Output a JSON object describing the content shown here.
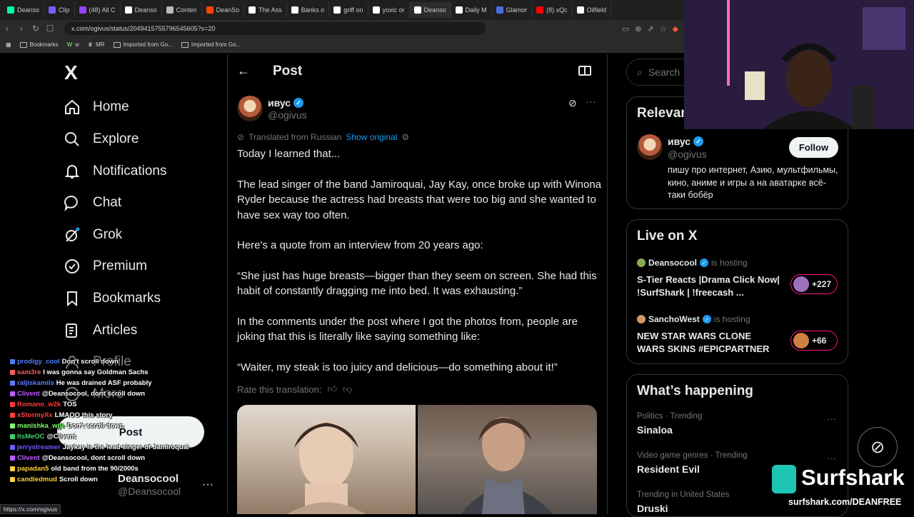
{
  "browser": {
    "tabs": [
      {
        "label": "Deanso",
        "color": "#0fa"
      },
      {
        "label": "Clip",
        "color": "#7a5cff"
      },
      {
        "label": "(48) All C",
        "color": "#9146ff"
      },
      {
        "label": "Deanso",
        "color": "#ffffff"
      },
      {
        "label": "Conten",
        "color": "#bbbbbb"
      },
      {
        "label": "DeanSo",
        "color": "#ff4500"
      },
      {
        "label": "The Ass",
        "color": "#ffffff"
      },
      {
        "label": "Banks o",
        "color": "#ffffff"
      },
      {
        "label": "griff on",
        "color": "#ffffff"
      },
      {
        "label": "yoxic or",
        "color": "#ffffff"
      },
      {
        "label": "Deanso",
        "color": "#ffffff"
      },
      {
        "label": "Daily M",
        "color": "#ffffff"
      },
      {
        "label": "Glamor",
        "color": "#4a6ee0"
      },
      {
        "label": "(8) xQc",
        "color": "#ff0000"
      },
      {
        "label": "Oilfield",
        "color": "#ffffff"
      }
    ],
    "url": "x.com/ogivus/status/2049415755796545605?s=20",
    "bookmarks": [
      "Bookmarks",
      "w",
      "MR",
      "Imported from Go...",
      "Imported from Go..."
    ],
    "status_url": "https://x.com/ogivus"
  },
  "nav": {
    "logo": "X",
    "items": [
      {
        "label": "Home"
      },
      {
        "label": "Explore"
      },
      {
        "label": "Notifications"
      },
      {
        "label": "Chat"
      },
      {
        "label": "Grok"
      },
      {
        "label": "Premium"
      },
      {
        "label": "Bookmarks"
      },
      {
        "label": "Articles"
      },
      {
        "label": "Profile"
      },
      {
        "label": "More"
      }
    ],
    "post_button": "Post",
    "account_name": "Deansocool",
    "account_handle": "@Deansocool"
  },
  "chat": [
    {
      "user": "prodigy_cool",
      "color": "#4f7dff",
      "msg": "Don't scroll down"
    },
    {
      "user": "sam3re",
      "color": "#ff5b5b",
      "msg": "I was gonna say Goldman Sachs"
    },
    {
      "user": "raljiskamils",
      "color": "#5b7bff",
      "msg": "He was drained ASF probably"
    },
    {
      "user": "Clivent",
      "color": "#c05bff",
      "msg": "@Deansocool, dont scroll down"
    },
    {
      "user": "Romano_w2k",
      "color": "#ff3b3b",
      "msg": "TOS"
    },
    {
      "user": "xStormyXx",
      "color": "#ff4040",
      "msg": "LMAOO this story"
    },
    {
      "user": "manishka_wjje",
      "color": "#7cff6b",
      "msg": "Don't scroll down"
    },
    {
      "user": "ItsMeOC",
      "color": "#3bd16b",
      "msg": "@Clivent"
    },
    {
      "user": "jerrystreamer",
      "color": "#6b5bff",
      "msg": "Jaykay is the lead singer of Jamiroquai"
    },
    {
      "user": "Clivent",
      "color": "#c05bff",
      "msg": "@Deansocool, dont scroll down"
    },
    {
      "user": "papadan5",
      "color": "#ffd23b",
      "msg": "old band from the 90/2000s"
    },
    {
      "user": "candiedmud",
      "color": "#ffd23b",
      "msg": "Scroll down"
    }
  ],
  "main": {
    "header_title": "Post",
    "author": {
      "name": "ивус",
      "handle": "@ogivus"
    },
    "translated_label": "Translated from Russian",
    "show_original": "Show original",
    "paragraphs": [
      "Today I learned that...",
      "The lead singer of the band Jamiroquai, Jay Kay, once broke up with Winona Ryder because the actress had breasts that were too big and she wanted to have sex way too often.",
      "Here's a quote from an interview from 20 years ago:",
      "“She just has huge breasts—bigger than they seem on screen. She had this habit of constantly dragging me into bed. It was exhausting.”",
      "In the comments under the post where I got the photos from, people are joking that this is literally like saying something like:",
      "“Waiter, my steak is too juicy and delicious—do something about it!”"
    ],
    "rate_label": "Rate this translation:"
  },
  "right": {
    "search_placeholder": "Search",
    "relevant": {
      "title": "Relevant people",
      "name": "ивус",
      "handle": "@ogivus",
      "follow_label": "Follow",
      "bio": "пишу про интернет, Азию, мультфильмы, кино, аниме и игры а на аватарке всё-таки бобёр"
    },
    "live": {
      "title": "Live on X",
      "items": [
        {
          "host": "Deansocool",
          "hosting": "is hosting",
          "title": "S-Tier Reacts |Drama Click Now| !SurfShark | !freecash ...",
          "count": "+227"
        },
        {
          "host": "SanchoWest",
          "hosting": "is hosting",
          "title": "NEW STAR WARS CLONE WARS SKINS #EPICPARTNER",
          "count": "+66"
        }
      ]
    },
    "happening": {
      "title": "What’s happening",
      "trends": [
        {
          "meta": "Politics · Trending",
          "name": "Sinaloa"
        },
        {
          "meta": "Video game genres · Trending",
          "name": "Resident Evil"
        },
        {
          "meta": "Trending in United States",
          "name": "Druski"
        }
      ]
    }
  },
  "overlay": {
    "surfshark_brand": "Surfshark",
    "surfshark_url": "surfshark.com/DEANFREE",
    "colors": {
      "accent": "#1d9bf0",
      "live": "#f91880",
      "surfshark": "#1ec4b4"
    }
  }
}
